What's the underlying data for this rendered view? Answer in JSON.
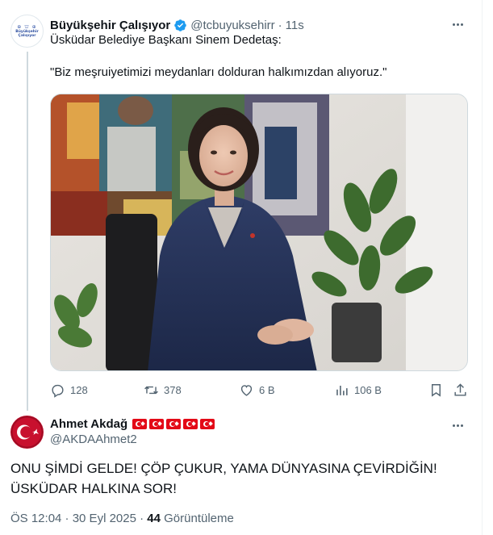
{
  "tweet1": {
    "author_name": "Büyükşehir Çalışıyor",
    "handle": "@tcbuyuksehirr",
    "separator": "·",
    "time": "11s",
    "text_line1": "Üsküdar Belediye Başkanı Sinem Dedetaş:",
    "text_quote": "\"Biz meşruiyetimizi meydanları dolduran halkımızdan alıyoruz.\"",
    "avatar_logo_top": "⊕ ⛫ ⊕",
    "avatar_logo_text": "Büyükşehir Çalışıyor",
    "stats": {
      "replies": "128",
      "retweets": "378",
      "likes": "6 B",
      "views": "106 B"
    }
  },
  "tweet2": {
    "author_name": "Ahmet Akdağ",
    "handle": "@AKDAAhmet2",
    "flags_count": 5,
    "text": "ONU ŞİMDİ GELDE! ÇÖP ÇUKUR, YAMA DÜNYASINA ÇEVİRDİĞİN! ÜSKÜDAR HALKINA SOR!",
    "meta_time": "ÖS 12:04 · 30 Eyl 2025 ·",
    "meta_views_count": "44",
    "meta_views_label": "Görüntüleme"
  },
  "icons": {
    "verified": "verified-badge-icon",
    "more": "more-icon",
    "reply": "reply-icon",
    "retweet": "retweet-icon",
    "like": "heart-icon",
    "views": "views-icon",
    "bookmark": "bookmark-icon",
    "share": "share-icon"
  },
  "colors": {
    "text": "#0f1419",
    "secondary": "#536471",
    "verified": "#1d9bf0",
    "flag_red": "#e30a17"
  }
}
